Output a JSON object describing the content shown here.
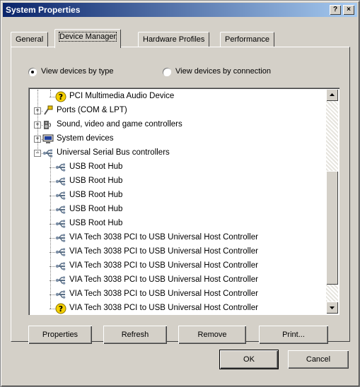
{
  "window": {
    "title": "System Properties",
    "help_label": "?",
    "close_label": "×"
  },
  "tabs": [
    {
      "label": "General"
    },
    {
      "label": "Device Manager"
    },
    {
      "label": "Hardware Profiles"
    },
    {
      "label": "Performance"
    }
  ],
  "view": {
    "by_type": "View devices by type",
    "by_connection": "View devices by connection",
    "selected": "by_type"
  },
  "tree": [
    {
      "label": "PCI Multimedia Audio Device",
      "icon": "warning-device-icon",
      "level": 1
    },
    {
      "label": "Ports (COM & LPT)",
      "icon": "port-icon",
      "level": 0,
      "expander": "+"
    },
    {
      "label": "Sound, video and game controllers",
      "icon": "sound-icon",
      "level": 0,
      "expander": "+"
    },
    {
      "label": "System devices",
      "icon": "computer-icon",
      "level": 0,
      "expander": "+"
    },
    {
      "label": "Universal Serial Bus controllers",
      "icon": "usb-icon",
      "level": 0,
      "expander": "−"
    },
    {
      "label": "USB Root Hub",
      "icon": "usb-icon",
      "level": 1
    },
    {
      "label": "USB Root Hub",
      "icon": "usb-icon",
      "level": 1
    },
    {
      "label": "USB Root Hub",
      "icon": "usb-icon",
      "level": 1
    },
    {
      "label": "USB Root Hub",
      "icon": "usb-icon",
      "level": 1
    },
    {
      "label": "USB Root Hub",
      "icon": "usb-icon",
      "level": 1
    },
    {
      "label": "VIA Tech 3038 PCI to USB Universal Host Controller",
      "icon": "usb-icon",
      "level": 1
    },
    {
      "label": "VIA Tech 3038 PCI to USB Universal Host Controller",
      "icon": "usb-icon",
      "level": 1
    },
    {
      "label": "VIA Tech 3038 PCI to USB Universal Host Controller",
      "icon": "usb-icon",
      "level": 1
    },
    {
      "label": "VIA Tech 3038 PCI to USB Universal Host Controller",
      "icon": "usb-icon",
      "level": 1
    },
    {
      "label": "VIA Tech 3038 PCI to USB Universal Host Controller",
      "icon": "usb-icon",
      "level": 1
    },
    {
      "label": "VIA Tech 3038 PCI to USB Universal Host Controller",
      "icon": "warning-device-icon",
      "level": 1
    }
  ],
  "actions": {
    "properties": "Properties",
    "refresh": "Refresh",
    "remove": "Remove",
    "print": "Print..."
  },
  "dialog": {
    "ok": "OK",
    "cancel": "Cancel"
  }
}
